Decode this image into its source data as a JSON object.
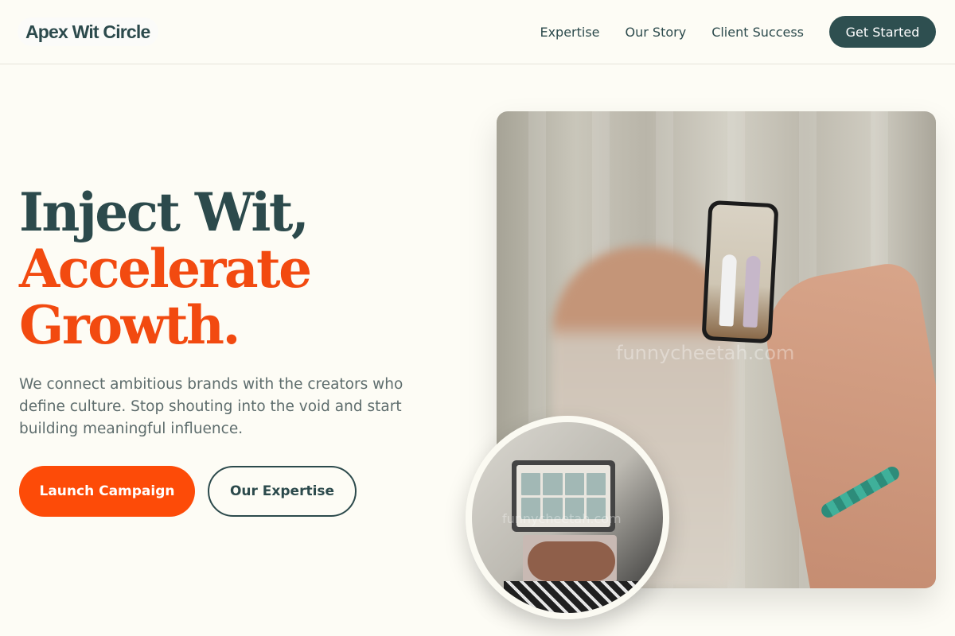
{
  "header": {
    "logo": "Apex Wit Circle",
    "nav": [
      {
        "label": "Expertise"
      },
      {
        "label": "Our Story"
      },
      {
        "label": "Client Success"
      }
    ],
    "cta": "Get Started"
  },
  "hero": {
    "headline_line1": "Inject Wit,",
    "headline_line2": "Accelerate",
    "headline_line3": "Growth.",
    "subtext": "We connect ambitious brands with the creators who define culture. Stop shouting into the void and start building meaningful influence.",
    "primary_button": "Launch Campaign",
    "secondary_button": "Our Expertise",
    "watermark_main": "funnycheetah.com",
    "watermark_circle": "funnycheetah.com"
  },
  "colors": {
    "background": "#fdfcf5",
    "primary_text": "#2c4a4c",
    "accent": "#f24a10",
    "primary_button": "#fd4b08",
    "header_cta": "#2e4f50"
  }
}
